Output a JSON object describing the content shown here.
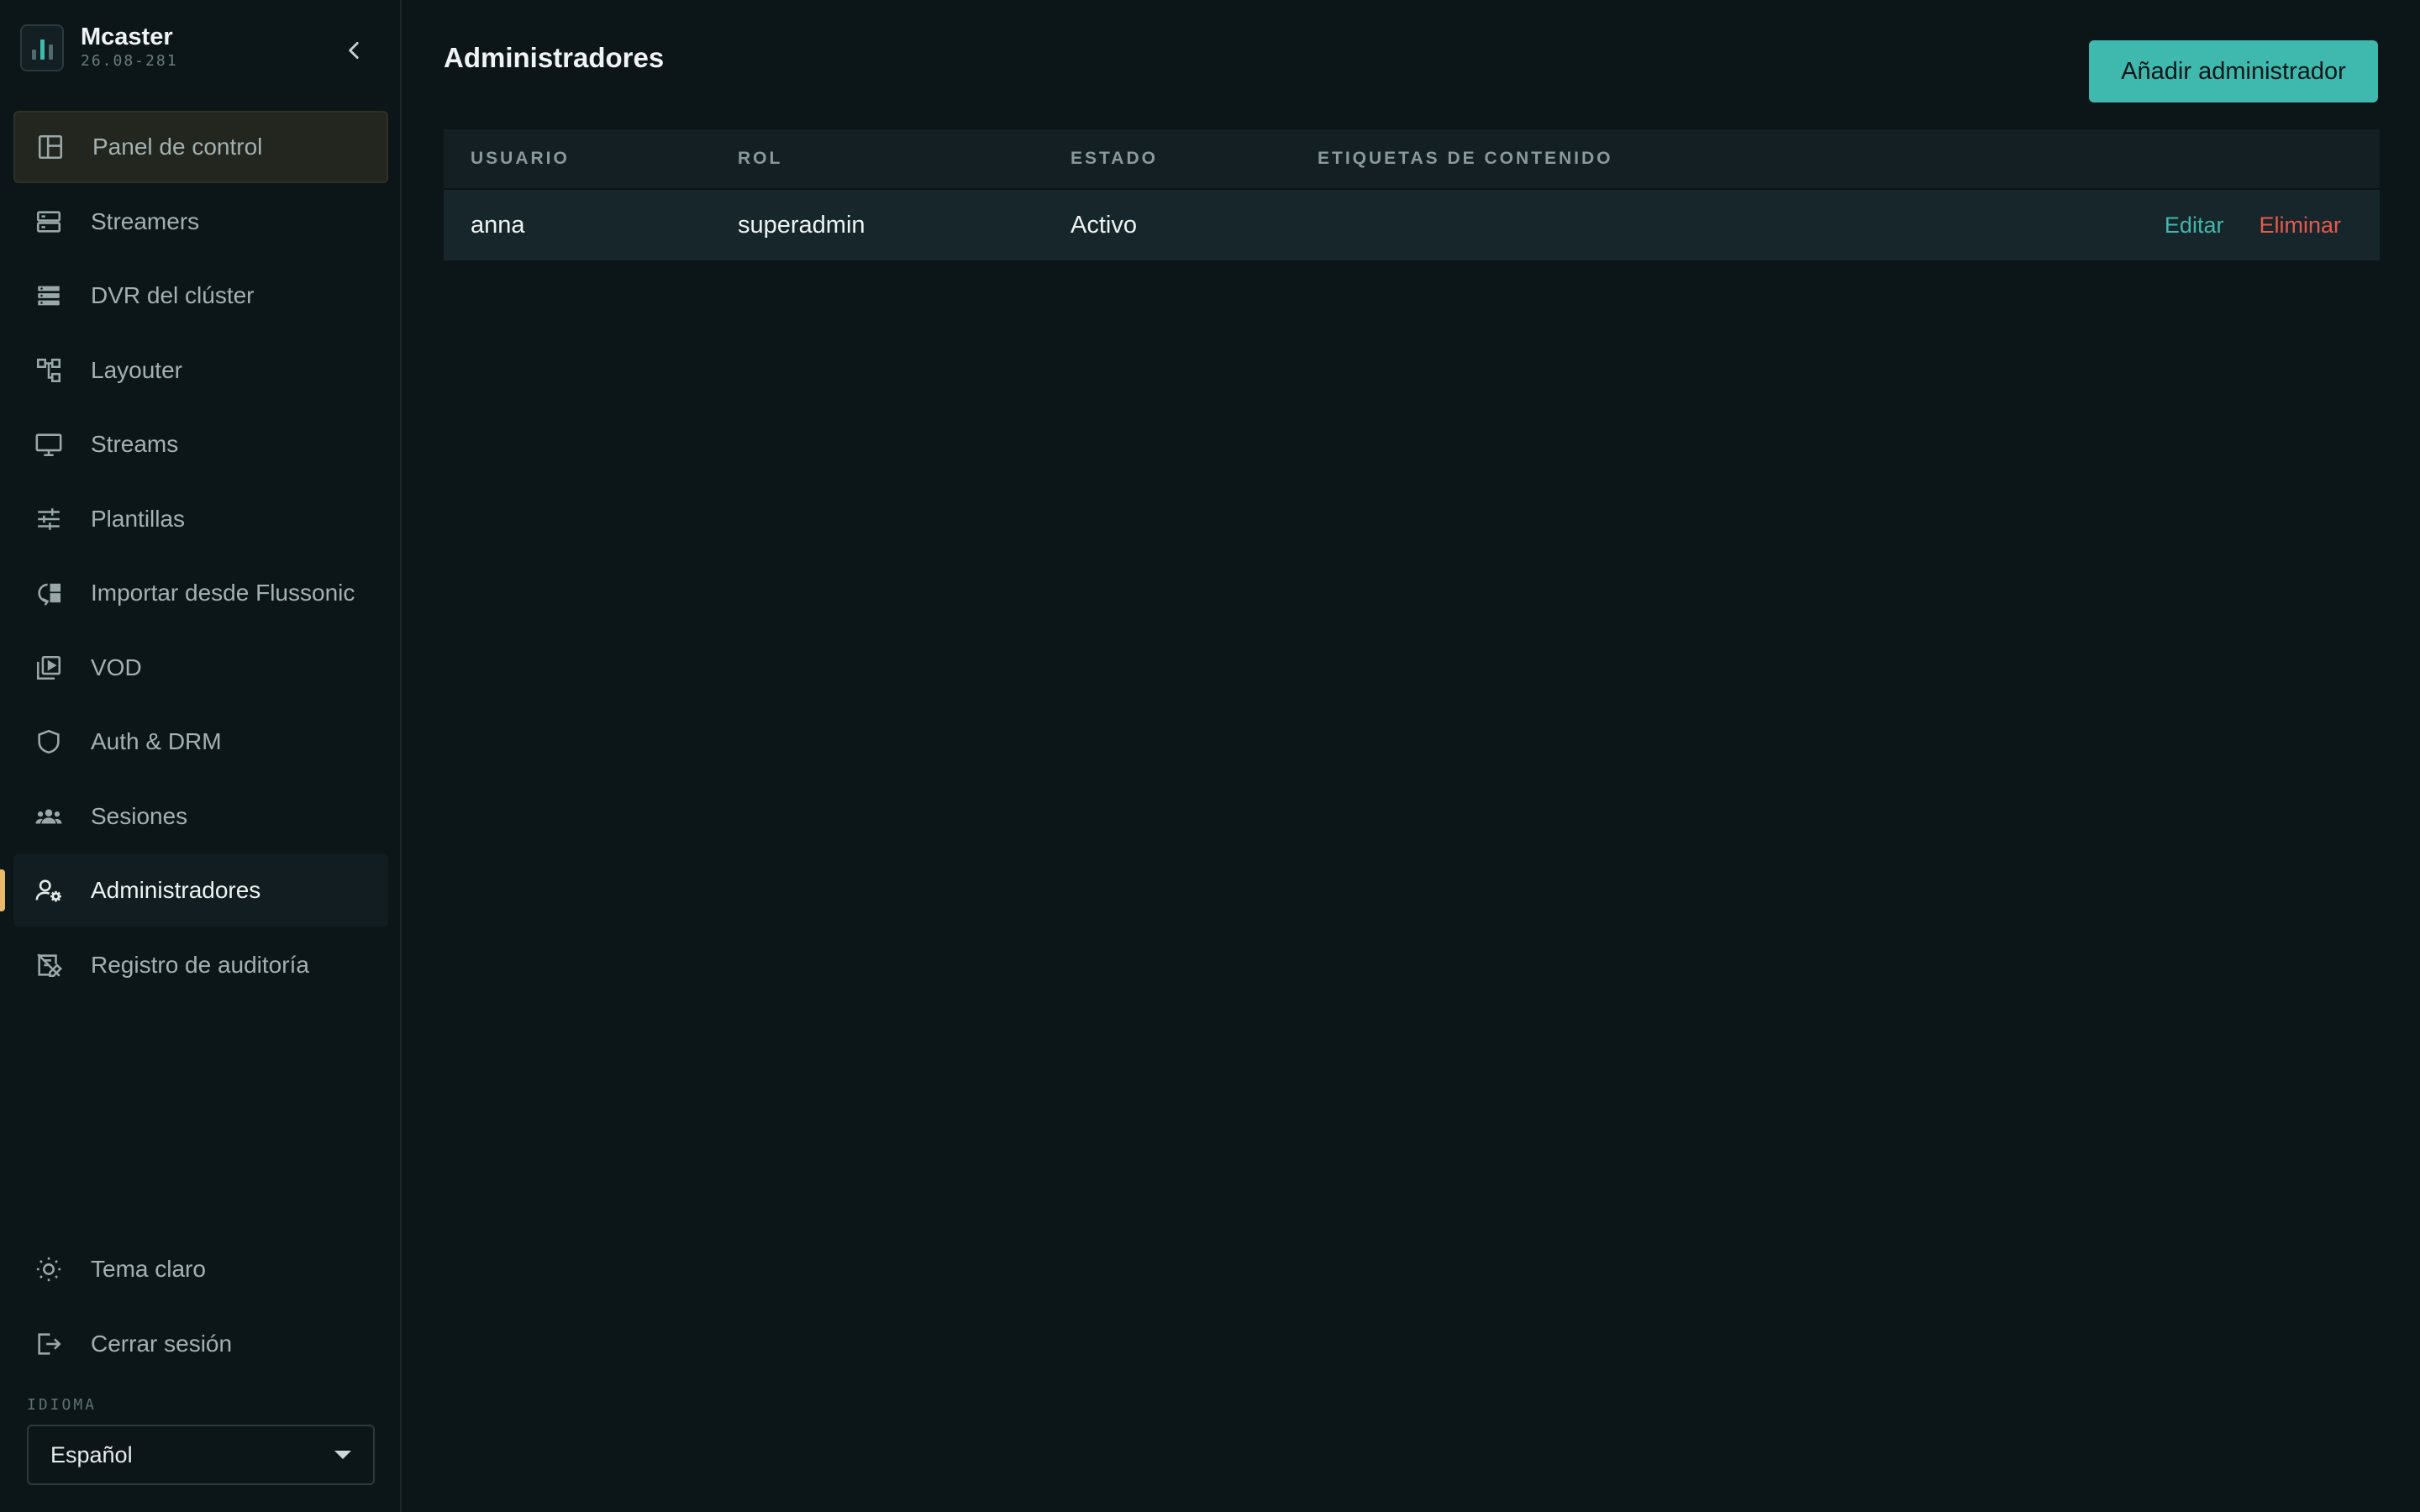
{
  "brand": {
    "name": "Mcaster",
    "version": "26.08-281"
  },
  "nav": {
    "items": [
      {
        "label": "Panel de control",
        "icon": "dashboard-icon"
      },
      {
        "label": "Streamers",
        "icon": "server-icon"
      },
      {
        "label": "DVR del clúster",
        "icon": "storage-icon"
      },
      {
        "label": "Layouter",
        "icon": "layout-tree-icon"
      },
      {
        "label": "Streams",
        "icon": "monitor-icon"
      },
      {
        "label": "Plantillas",
        "icon": "sliders-icon"
      },
      {
        "label": "Importar desde Flussonic",
        "icon": "import-icon"
      },
      {
        "label": "VOD",
        "icon": "video-library-icon"
      },
      {
        "label": "Auth & DRM",
        "icon": "shield-icon"
      },
      {
        "label": "Sesiones",
        "icon": "users-group-icon"
      },
      {
        "label": "Administradores",
        "icon": "user-gear-icon"
      },
      {
        "label": "Registro de auditoría",
        "icon": "audit-log-icon"
      }
    ],
    "bottom": [
      {
        "label": "Tema claro",
        "icon": "sun-icon"
      },
      {
        "label": "Cerrar sesión",
        "icon": "logout-icon"
      }
    ]
  },
  "language": {
    "label": "IDIOMA",
    "selected": "Español"
  },
  "page": {
    "title": "Administradores",
    "add_button": "Añadir administrador"
  },
  "table": {
    "columns": [
      "USUARIO",
      "ROL",
      "ESTADO",
      "ETIQUETAS DE CONTENIDO"
    ],
    "rows": [
      {
        "user": "anna",
        "role": "superadmin",
        "status": "Activo",
        "tags": "",
        "edit": "Editar",
        "delete": "Eliminar"
      }
    ]
  },
  "colors": {
    "accent": "#3fb8ad",
    "danger": "#e8584f",
    "active_marker": "#e9b96a",
    "background": "#0c1619"
  }
}
